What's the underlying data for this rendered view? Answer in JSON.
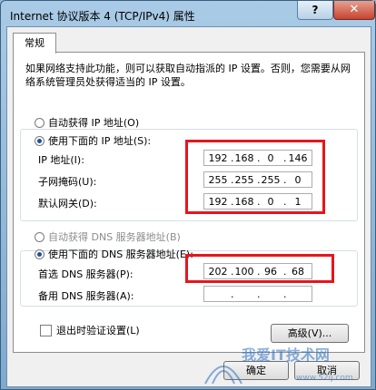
{
  "window": {
    "title": "Internet 协议版本 4 (TCP/IPv4) 属性",
    "help_label": "?",
    "close_label": "✕"
  },
  "tab": {
    "label": "常规"
  },
  "description": "如果网络支持此功能，则可以获取自动指派的 IP 设置。否则，您需要从网络系统管理员处获得适当的 IP 设置。",
  "ip": {
    "auto_label": "自动获得 IP 地址(O)",
    "manual_label": "使用下面的 IP 地址(S):",
    "address": {
      "label": "IP 地址(I):",
      "octets": [
        "192",
        "168",
        "0",
        "146"
      ]
    },
    "subnet": {
      "label": "子网掩码(U):",
      "octets": [
        "255",
        "255",
        "255",
        "0"
      ]
    },
    "gateway": {
      "label": "默认网关(D):",
      "octets": [
        "192",
        "168",
        "0",
        "1"
      ]
    }
  },
  "dns": {
    "auto_label": "自动获得 DNS 服务器地址(B)",
    "manual_label": "使用下面的 DNS 服务器地址(E):",
    "preferred": {
      "label": "首选 DNS 服务器(P):",
      "octets": [
        "202",
        "100",
        "96",
        "68"
      ]
    },
    "alternate": {
      "label": "备用 DNS 服务器(A):",
      "octets": [
        "",
        "",
        "",
        ""
      ]
    }
  },
  "validate_label": "退出时验证设置(L)",
  "advanced_label": "高级(V)...",
  "ok_label": "确定",
  "cancel_label": "取消",
  "watermark": {
    "text": "我爱IT技术网",
    "url": "www.52ij.com"
  },
  "colors": {
    "highlight": "#e8141c",
    "title_bar": "#a9cbe6"
  }
}
